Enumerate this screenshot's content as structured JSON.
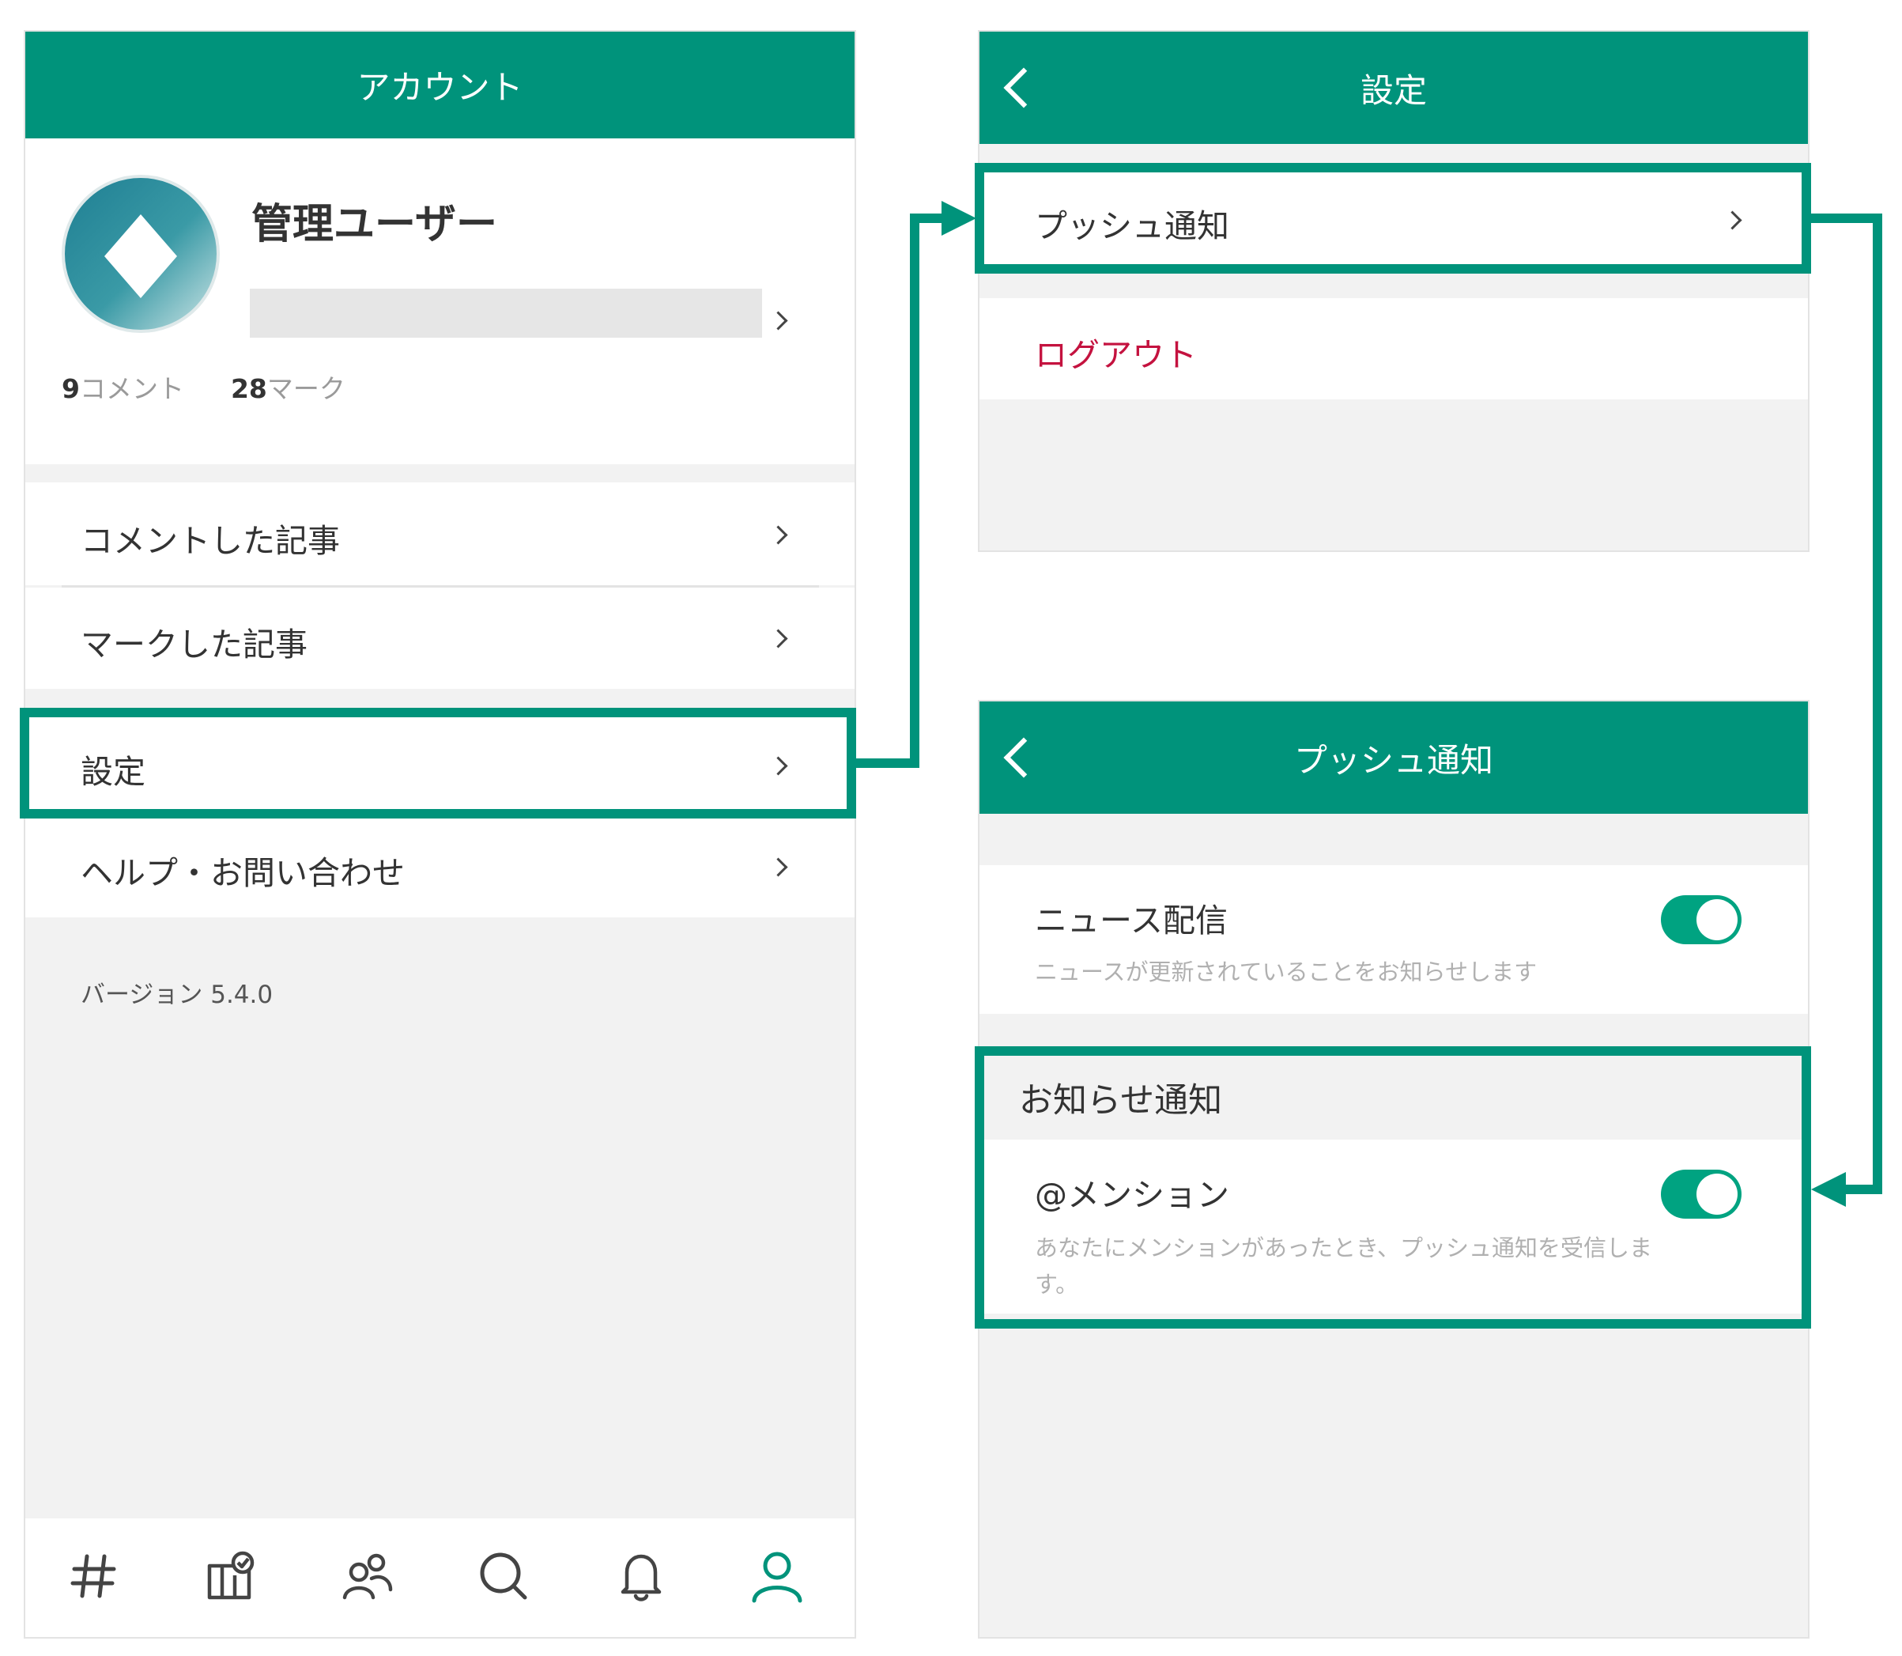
{
  "account": {
    "title": "アカウント",
    "username": "管理ユーザー",
    "stats": {
      "comments_count": "9",
      "comments_label": "コメント",
      "marks_count": "28",
      "marks_label": "マーク"
    },
    "menu": {
      "commented": "コメントした記事",
      "marked": "マークした記事",
      "settings": "設定",
      "help": "ヘルプ・お問い合わせ"
    },
    "version": "バージョン 5.4.0",
    "tabs": [
      "hashtag-icon",
      "board-check-icon",
      "people-icon",
      "search-icon",
      "bell-icon",
      "profile-icon"
    ]
  },
  "settings": {
    "title": "設定",
    "push": "プッシュ通知",
    "logout": "ログアウト"
  },
  "push": {
    "title": "プッシュ通知",
    "news_title": "ニュース配信",
    "news_desc": "ニュースが更新されていることをお知らせします",
    "news_enabled": true,
    "section": "お知らせ通知",
    "mention_title": "@メンション",
    "mention_desc_line1": "あなたにメンションがあったとき、プッシュ通知を受信しま",
    "mention_desc_line2": "す。",
    "mention_enabled": true
  },
  "colors": {
    "brand": "#00937b",
    "toggle_on": "#00a381",
    "danger": "#c4123f"
  }
}
